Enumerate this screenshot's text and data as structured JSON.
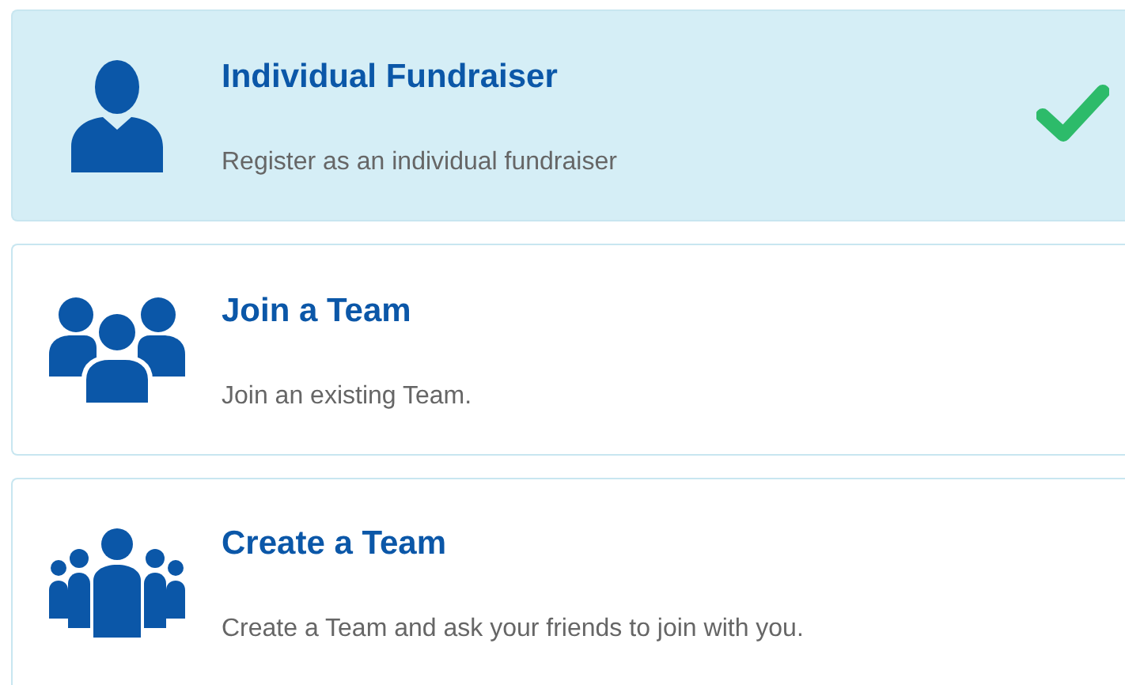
{
  "options": [
    {
      "kind": "person",
      "title": "Individual Fundraiser",
      "description": "Register as an individual fundraiser",
      "selected": true
    },
    {
      "kind": "team",
      "title": "Join a Team",
      "description": "Join an existing Team.",
      "selected": false
    },
    {
      "kind": "crowd",
      "title": "Create a Team",
      "description": "Create a Team and ask your friends to join with you.",
      "selected": false
    }
  ]
}
